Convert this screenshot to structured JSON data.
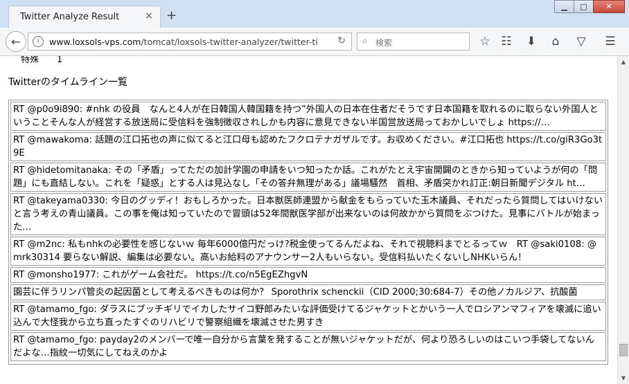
{
  "browser": {
    "tab_title": "Twitter Analyze Result",
    "tab_close": "×",
    "new_tab": "+",
    "win_min": "▁",
    "win_max": "□",
    "win_close": "✕",
    "url_host": "www.loxsols-vps.com",
    "url_path": "/tomcat/loxsols-twitter-analyzer/twitter-ti",
    "search_placeholder": "検索"
  },
  "page": {
    "cut_text": "特殊　　1",
    "heading": "Twitterのタイムライン一覧",
    "tweets": [
      "RT @p0o9i890: #nhk の役員　なんと4人が在日韓国人韓国籍を持つ”外国人の日本在住者だそうです日本国籍を取れるのに取らない外国人ということそんな人が経営する放送局に受信料を強制徴収されしかも内容に意見できない半国営放送局っておかしいでしょ https://…",
      "RT @mawakoma: 話題の江口拓也の声に似てると江口母も認めたフクロテナガザルです。お収めください。#江口拓也 https://t.co/giR3Go3t9E",
      "RT @hidetomitanaka: その「矛盾」ってただの加計学園の申請をいつ知ったか話。これがたとえ宇宙開闢のときから知っていようが何の「問題」にも直結しない。これを「疑惑」とする人は見込なし「その答弁無理がある」議場騒然　首相、矛盾突かれ訂正:朝日新聞デジタル ht…",
      "RT @takeyama0330: 今日のグッディ！おもしろかった。日本獣医師連盟から献金をもらっていた玉木議員、それだったら質問してはいけないと言う考えの青山議員。この事を俺は知っていたので冒頭は52年間獣医学部が出来ないのは何故かから質問をぶつけた。見事にバトルが始まった…",
      "RT @m2nc: 私もnhkの必要性を感じないｗ 毎年6000億円だっけ?税金使ってるんだよね、それで視聴料までとるってｗ　RT @saki0108: @mrk30314 要らない解説、編集は必要ない。高いお給料のアナウンサー2人もいらない。受信料払いたくないしNHKいらん！",
      "RT @monsho1977: これがゲーム会社だ。 https://t.co/n5EgEZhgvN",
      "園芸に伴うリンパ管炎の起因菌として考えるべきものは何か？ Sporothrix schenckii（CID 2000;30:684-7）その他ノカルジア、抗酸菌",
      "RT @tamamo_fgo: ダラスにブッチギリでイカしたサイコ野郎みたいな評価受けてるジャケットとかいう一人でロシアンマフィアを壊滅に追い込んで大怪我から立ち直ったすぐのリハビリで警察組織を壊滅させた男すき",
      "RT @tamamo_fgo: payday2のメンバーで唯一自分から言葉を発することが無いジャケットだが、何より恐ろしいのはこいつ手袋してないんだよな…指紋一切気にしてねえのかよ"
    ]
  }
}
